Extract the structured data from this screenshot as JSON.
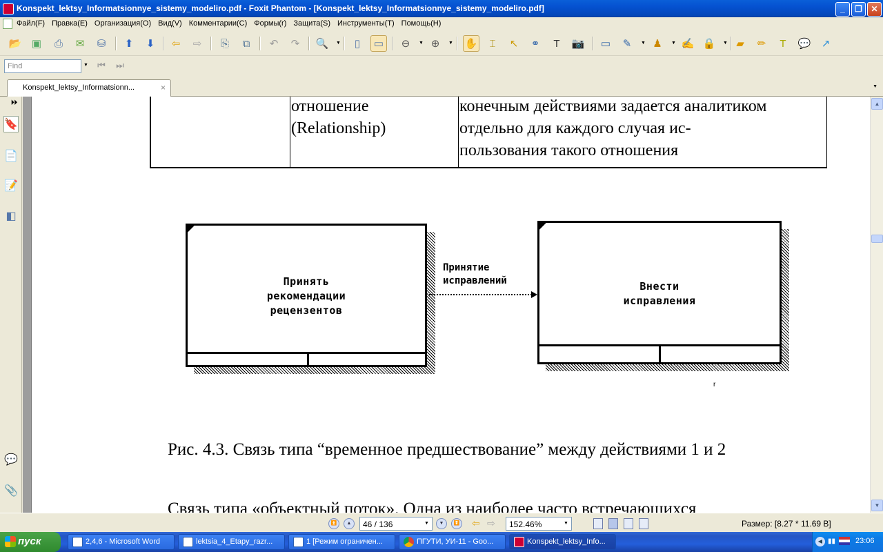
{
  "window": {
    "title": "Konspekt_lektsy_Informatsionnye_sistemy_modeliro.pdf - Foxit Phantom - [Konspekt_lektsy_Informatsionnye_sistemy_modeliro.pdf]",
    "minimize": "_",
    "maximize": "❐",
    "close": "✕"
  },
  "menu": [
    "Файл(F)",
    "Правка(E)",
    "Организация(O)",
    "Вид(V)",
    "Комментарии(C)",
    "Формы(r)",
    "Защита(S)",
    "Инструменты(T)",
    "Помощь(H)"
  ],
  "find": {
    "placeholder": "Find"
  },
  "tab": {
    "label": "Konspekt_lektsy_Informatsionn...",
    "close": "×"
  },
  "document": {
    "table_rows": {
      "col2": [
        "отношение",
        "(Relationship)"
      ],
      "col3": [
        "конечным действиями задается аналитиком",
        "отдельно для каждого случая ис-",
        "пользования такого отношения"
      ]
    },
    "diagram": {
      "box1": [
        "Принять",
        "рекомендации",
        "рецензентов"
      ],
      "box2": [
        "Внести",
        "исправления"
      ],
      "arrow_label": [
        "Принятие",
        "исправлений"
      ],
      "stray_mark": "r"
    },
    "caption": "Рис. 4.3. Связь типа “временное предшествование” между действиями 1 и 2",
    "next_paragraph": "Связь типа «объектный поток». Одна из наиболее часто встречающихся"
  },
  "status": {
    "page": "46 / 136",
    "zoom": "152.46%",
    "size": "Размер: [8.27 * 11.69 В]"
  },
  "taskbar": {
    "start": "пуск",
    "items": [
      "2,4,6 - Microsoft Word",
      "lektsia_4_Etapy_razr...",
      "1 [Режим ограничен...",
      "ПГУТИ, УИ-11 - Goo...",
      "Konspekt_lektsy_Info..."
    ],
    "clock": "23:06"
  },
  "colors": {
    "titlebar": "#0551d0",
    "chrome": "#ece9d8",
    "taskbar": "#245edb",
    "start_button": "#3c963b"
  }
}
